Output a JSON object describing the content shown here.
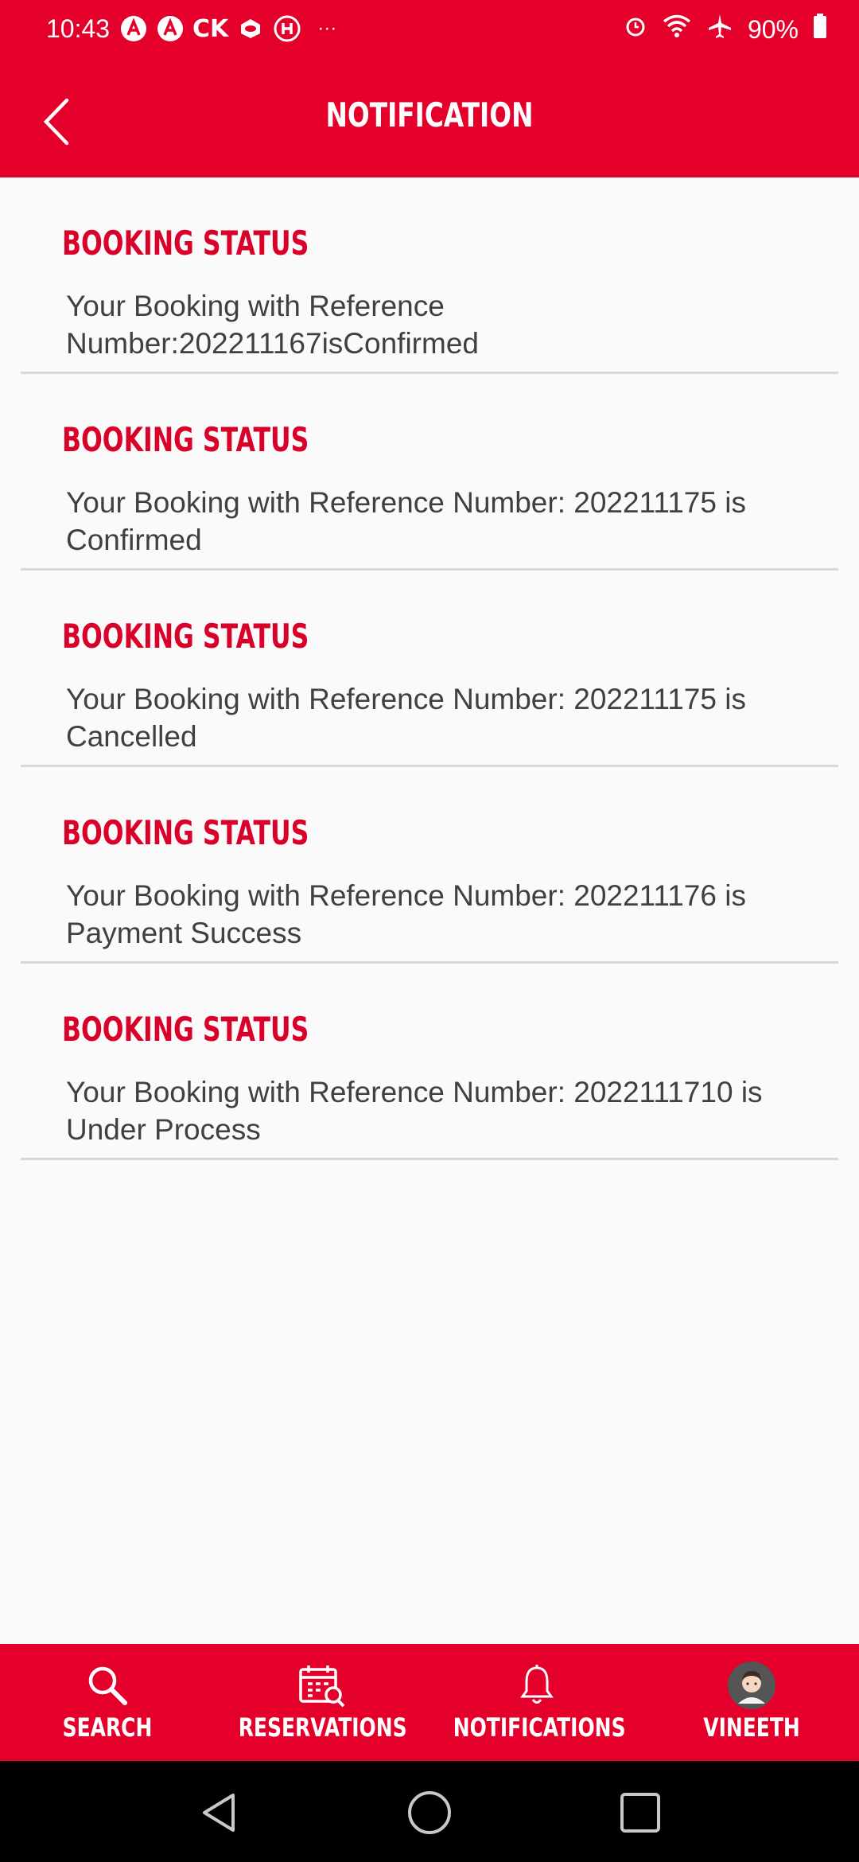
{
  "status_bar": {
    "time": "10:43",
    "carrier_text": "CK",
    "more": "···",
    "battery": "90%"
  },
  "header": {
    "title": "NOTIFICATION"
  },
  "notifications": [
    {
      "title": "BOOKING STATUS",
      "message": "Your Booking with Reference Number:202211167isConfirmed"
    },
    {
      "title": "BOOKING STATUS",
      "message": "Your Booking with Reference Number: 202211175 is Confirmed"
    },
    {
      "title": "BOOKING STATUS",
      "message": "Your Booking with Reference Number: 202211175 is Cancelled"
    },
    {
      "title": "BOOKING STATUS",
      "message": "Your Booking with Reference Number: 202211176 is Payment Success"
    },
    {
      "title": "BOOKING STATUS",
      "message": "Your Booking with Reference Number: 2022111710 is Under Process"
    }
  ],
  "bottom_nav": [
    {
      "label": "SEARCH",
      "icon": "search-icon"
    },
    {
      "label": "RESERVATIONS",
      "icon": "calendar-search-icon"
    },
    {
      "label": "NOTIFICATIONS",
      "icon": "bell-icon"
    },
    {
      "label": "VINEETH",
      "icon": "avatar"
    }
  ],
  "colors": {
    "brand_red": "#e4002b",
    "title_red": "#d9002a",
    "text_gray": "#404040"
  }
}
